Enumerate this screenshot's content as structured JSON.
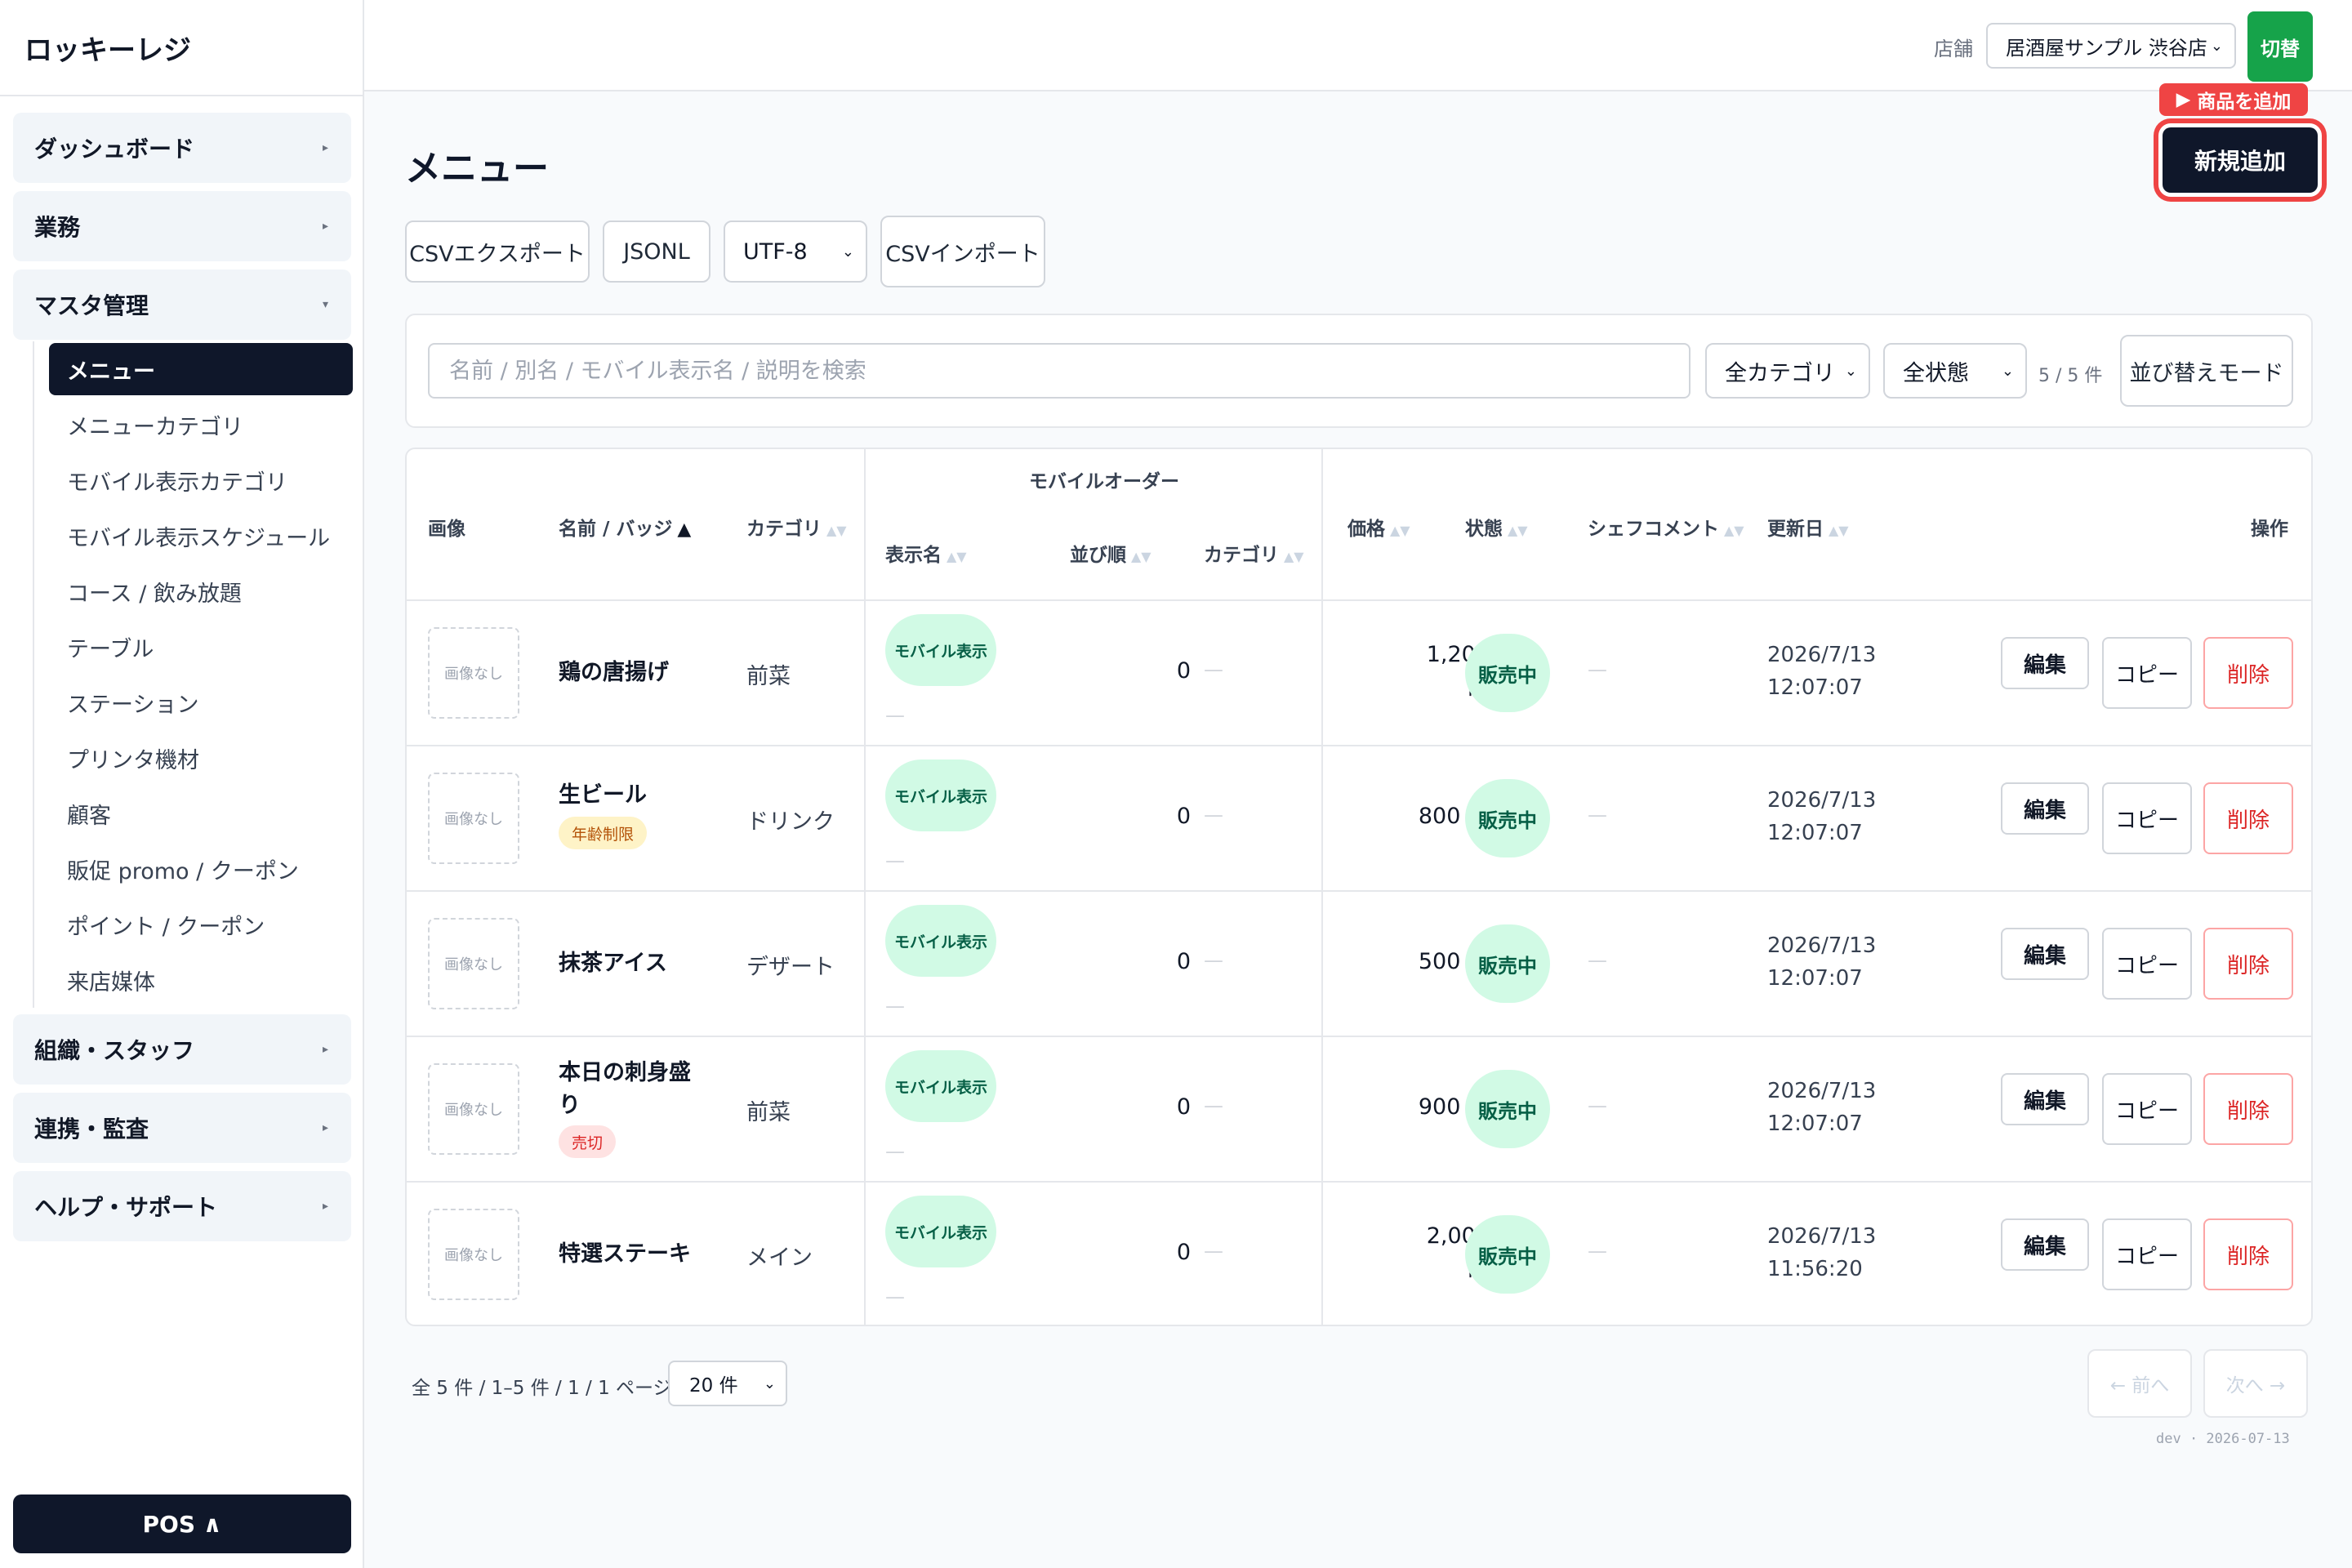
{
  "app": {
    "title": "ロッキーレジ"
  },
  "sidebar": {
    "sections": [
      {
        "label": "ダッシュボード",
        "caret": "▸"
      },
      {
        "label": "業務",
        "caret": "▸"
      },
      {
        "label": "マスタ管理",
        "caret": "▾"
      },
      {
        "label": "組織・スタッフ",
        "caret": "▸"
      },
      {
        "label": "連携・監査",
        "caret": "▸"
      },
      {
        "label": "ヘルプ・サポート",
        "caret": "▸"
      }
    ],
    "master_items": [
      "メニュー",
      "メニューカテゴリ",
      "モバイル表示カテゴリ",
      "モバイル表示スケジュール",
      "コース / 飲み放題",
      "テーブル",
      "ステーション",
      "プリンタ機材",
      "顧客",
      "販促 promo / クーポン",
      "ポイント / クーポン",
      "来店媒体"
    ],
    "active_item": "メニュー",
    "pos_button": "POS ∧"
  },
  "topbar": {
    "store_label": "店舗",
    "store_value": "居酒屋サンプル 渋谷店",
    "switch_button": "切替"
  },
  "page": {
    "title": "メニュー",
    "add_tip": "商品を追加",
    "add_button": "新規追加",
    "toolbar": {
      "csv_export": "CSVエクスポート",
      "jsonl": "JSONL",
      "encoding": "UTF-8",
      "csv_import": "CSVインポート"
    },
    "filters": {
      "search_placeholder": "名前 / 別名 / モバイル表示名 / 説明を検索",
      "category": "全カテゴリ",
      "status": "全状態",
      "count": "5 / 5 件",
      "sort_mode": "並び替えモード"
    }
  },
  "table": {
    "headers": {
      "image": "画像",
      "name": "名前 / バッジ",
      "category": "カテゴリ",
      "mobile_group": "モバイルオーダー",
      "display_name": "表示名",
      "order": "並び順",
      "mobile_category": "カテゴリ",
      "price": "価格",
      "status": "状態",
      "chef_comment": "シェフコメント",
      "updated": "更新日",
      "actions": "操作"
    },
    "rows": [
      {
        "image": "画像なし",
        "name": [
          "鶏の唐揚げ"
        ],
        "badge": "",
        "category": "前菜",
        "mobile": "モバイル表示",
        "display_name": "—",
        "order": "0",
        "mobile_category": "—",
        "price": [
          "1,200",
          "円"
        ],
        "status": "販売中",
        "chef_comment": "—",
        "updated": [
          "2026/7/13",
          "12:07:07"
        ],
        "edit": "編集",
        "copy": "コピー",
        "delete": "削除"
      },
      {
        "image": "画像なし",
        "name": [
          "生ビール"
        ],
        "badge": "年齢制限",
        "category": "ドリンク",
        "mobile": "モバイル表示",
        "display_name": "—",
        "order": "0",
        "mobile_category": "—",
        "price": [
          "800 円"
        ],
        "status": "販売中",
        "chef_comment": "—",
        "updated": [
          "2026/7/13",
          "12:07:07"
        ],
        "edit": "編集",
        "copy": "コピー",
        "delete": "削除"
      },
      {
        "image": "画像なし",
        "name": [
          "抹茶アイス"
        ],
        "badge": "",
        "category": "デザート",
        "mobile": "モバイル表示",
        "display_name": "—",
        "order": "0",
        "mobile_category": "—",
        "price": [
          "500 円"
        ],
        "status": "販売中",
        "chef_comment": "—",
        "updated": [
          "2026/7/13",
          "12:07:07"
        ],
        "edit": "編集",
        "copy": "コピー",
        "delete": "削除"
      },
      {
        "image": "画像なし",
        "name": [
          "本日の刺身盛",
          "り"
        ],
        "badge": "売切",
        "category": "前菜",
        "mobile": "モバイル表示",
        "display_name": "—",
        "order": "0",
        "mobile_category": "—",
        "price": [
          "900 円"
        ],
        "status": "販売中",
        "chef_comment": "—",
        "updated": [
          "2026/7/13",
          "12:07:07"
        ],
        "edit": "編集",
        "copy": "コピー",
        "delete": "削除"
      },
      {
        "image": "画像なし",
        "name": [
          "特選ステーキ"
        ],
        "badge": "",
        "category": "メイン",
        "mobile": "モバイル表示",
        "display_name": "—",
        "order": "0",
        "mobile_category": "—",
        "price": [
          "2,000",
          "円"
        ],
        "status": "販売中",
        "chef_comment": "—",
        "updated": [
          "2026/7/13",
          "11:56:20"
        ],
        "edit": "編集",
        "copy": "コピー",
        "delete": "削除"
      }
    ]
  },
  "footer": {
    "page_info": "全 5 件 / 1–5 件 / 1 / 1 ページ",
    "per_page": "20 件",
    "prev": "← 前へ",
    "next": "次へ →",
    "dev_tag": "dev · 2026-07-13"
  },
  "colors": {
    "primary_dark": "#0f172a",
    "accent_green": "#16a34a",
    "highlight_red": "#ef4444",
    "pill_green_bg": "#d1fae5"
  },
  "icons": {
    "sort_asc": "▲",
    "sort_both": "▲▼",
    "play": "▶",
    "select_chevron": "⌄"
  }
}
